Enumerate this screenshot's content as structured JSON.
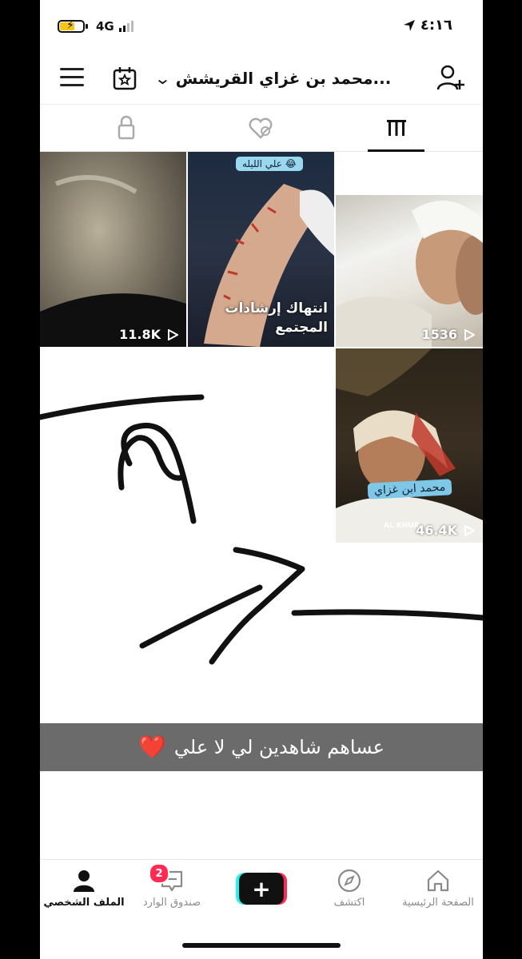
{
  "status_bar": {
    "network": "4G",
    "time": "٤:١٦"
  },
  "header": {
    "title": "محمد بن غزاي القريشش...",
    "icons": [
      "menu-icon",
      "calendar-icon",
      "chevron-down-icon",
      "add-user-icon"
    ]
  },
  "tabs": [
    {
      "name": "private",
      "icon": "lock-icon"
    },
    {
      "name": "liked",
      "icon": "hidden-heart-icon"
    },
    {
      "name": "videos",
      "icon": "grid-icon",
      "active": true
    }
  ],
  "videos": [
    {
      "views": "1536",
      "caption": ""
    },
    {
      "views": "",
      "caption": "انتهاك إرشادات المجتمع",
      "sticker": "علي الليله 😂"
    },
    {
      "views": "11.8K",
      "caption": ""
    },
    {
      "views": "46.4K",
      "caption": "محمد ابن غزاي",
      "watermark": "AL KHUR"
    }
  ],
  "story_caption": {
    "text": "عساهم شاهدين لي لا علي",
    "emoji": "❤️"
  },
  "bottom_nav": {
    "home": "الصفحة الرئيسية",
    "discover": "اكتشف",
    "create": "+",
    "inbox": "صندوق الوارد",
    "inbox_badge": "2",
    "profile": "الملف الشخصي"
  },
  "colors": {
    "accent_red": "#fe2c55",
    "accent_cyan": "#25f4ee",
    "caption_bar": "#6b6b6b"
  }
}
